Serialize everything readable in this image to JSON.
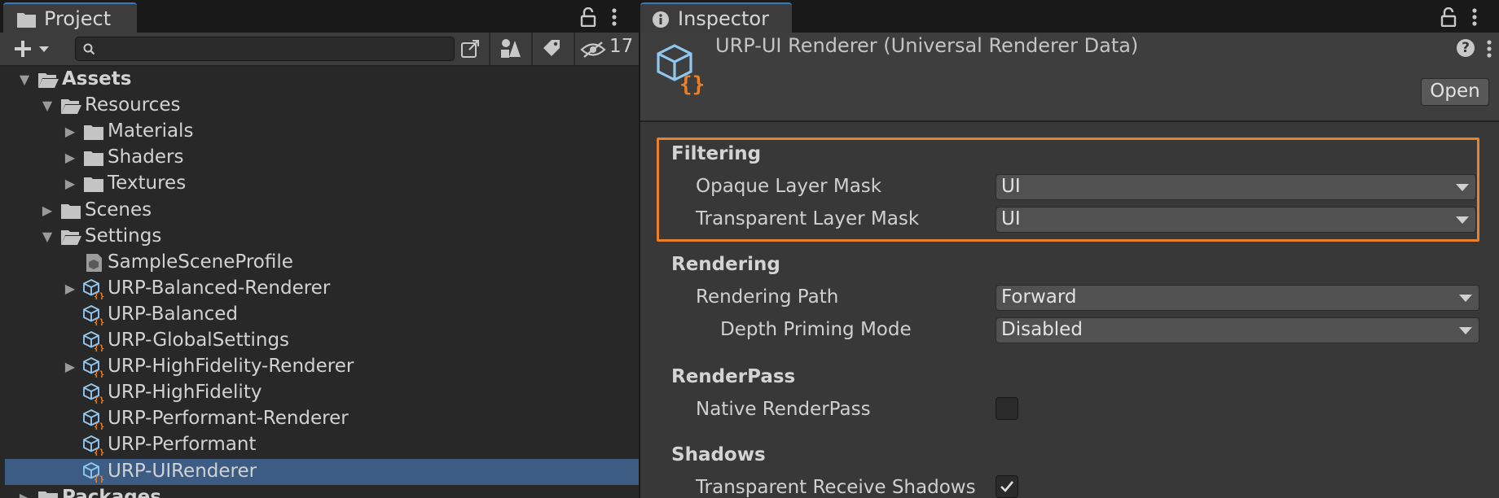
{
  "project": {
    "tab_label": "Project",
    "hidden_count": "17",
    "search": {
      "placeholder": ""
    },
    "tree": [
      {
        "label": "Assets",
        "depth": 0,
        "arrow": "down",
        "icon": "folder-open",
        "bold": true
      },
      {
        "label": "Resources",
        "depth": 1,
        "arrow": "down",
        "icon": "folder-open"
      },
      {
        "label": "Materials",
        "depth": 2,
        "arrow": "right",
        "icon": "folder"
      },
      {
        "label": "Shaders",
        "depth": 2,
        "arrow": "right",
        "icon": "folder"
      },
      {
        "label": "Textures",
        "depth": 2,
        "arrow": "right",
        "icon": "folder"
      },
      {
        "label": "Scenes",
        "depth": 1,
        "arrow": "right",
        "icon": "folder"
      },
      {
        "label": "Settings",
        "depth": 1,
        "arrow": "down",
        "icon": "folder-open"
      },
      {
        "label": "SampleSceneProfile",
        "depth": 2,
        "arrow": "none",
        "icon": "profile"
      },
      {
        "label": "URP-Balanced-Renderer",
        "depth": 2,
        "arrow": "right",
        "icon": "renderer-data"
      },
      {
        "label": "URP-Balanced",
        "depth": 2,
        "arrow": "none",
        "icon": "renderer-data"
      },
      {
        "label": "URP-GlobalSettings",
        "depth": 2,
        "arrow": "none",
        "icon": "renderer-data"
      },
      {
        "label": "URP-HighFidelity-Renderer",
        "depth": 2,
        "arrow": "right",
        "icon": "renderer-data"
      },
      {
        "label": "URP-HighFidelity",
        "depth": 2,
        "arrow": "none",
        "icon": "renderer-data"
      },
      {
        "label": "URP-Performant-Renderer",
        "depth": 2,
        "arrow": "none",
        "icon": "renderer-data"
      },
      {
        "label": "URP-Performant",
        "depth": 2,
        "arrow": "none",
        "icon": "renderer-data"
      },
      {
        "label": "URP-UIRenderer",
        "depth": 2,
        "arrow": "none",
        "icon": "renderer-data",
        "selected": true
      },
      {
        "label": "Packages",
        "depth": 0,
        "arrow": "right",
        "icon": "folder",
        "bold": true
      }
    ]
  },
  "inspector": {
    "tab_label": "Inspector",
    "asset_title": "URP-UI Renderer (Universal Renderer Data)",
    "open_button": "Open",
    "help_icon": "?",
    "highlight_color": "#e8822a",
    "sections": {
      "filtering": {
        "title": "Filtering",
        "opaque_label": "Opaque Layer Mask",
        "opaque_value": "UI",
        "transparent_label": "Transparent Layer Mask",
        "transparent_value": "UI"
      },
      "rendering": {
        "title": "Rendering",
        "path_label": "Rendering Path",
        "path_value": "Forward",
        "depth_label": "Depth Priming Mode",
        "depth_value": "Disabled"
      },
      "renderpass": {
        "title": "RenderPass",
        "native_label": "Native RenderPass",
        "native_checked": false
      },
      "shadows": {
        "title": "Shadows",
        "receive_label": "Transparent Receive Shadows",
        "receive_checked": true
      }
    }
  }
}
